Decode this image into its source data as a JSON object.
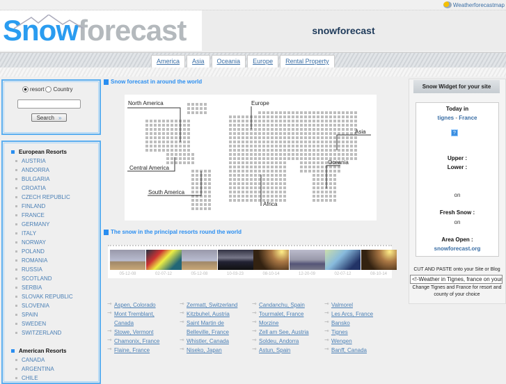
{
  "topbar": {
    "link": "Weatherforecastmap"
  },
  "header": {
    "logo_snow": "Snow",
    "logo_forecast": "forecast",
    "title": "snowforecast"
  },
  "nav": {
    "tabs": [
      "America",
      "Asia",
      "Oceania",
      "Europe",
      "Rental Property"
    ]
  },
  "search": {
    "option_resort": "resort",
    "option_country": "Country",
    "input_value": "",
    "button": "Search",
    "button_icon": "»"
  },
  "sidebar": {
    "european_title": "European Resorts",
    "european": [
      "AUSTRIA",
      "ANDORRA",
      "BULGARIA",
      "CROATIA",
      "CZECH REPUBLIC",
      "FINLAND",
      "FRANCE",
      "GERMANY",
      "ITALY",
      "NORWAY",
      "POLAND",
      "ROMANIA",
      "RUSSIA",
      "SCOTLAND",
      "SERBIA",
      "SLOVAK REPUBLIC",
      "SLOVENIA",
      "SPAIN",
      "SWEDEN",
      "SWITZERLAND"
    ],
    "american_title": "American Resorts",
    "american": [
      "CANADA",
      "ARGENTINA",
      "CHILE"
    ]
  },
  "main": {
    "map_title": "Snow forecast in around the world",
    "map_labels": {
      "north_america": "North America",
      "europe": "Europe",
      "asia": "Asia",
      "central_america": "Central America",
      "oceania": "Oceania",
      "south_america": "South America",
      "africa": "Africa"
    },
    "photos_title": "The snow in the principal resorts round the world",
    "photo_dates": [
      "05-12-08",
      "02-07-12",
      "05-12-08",
      "10-03-23",
      "08-10-14",
      "12-20-09",
      "02-07-12",
      "08-10-14"
    ],
    "resort_columns": [
      [
        "Aspen, Colorado",
        "Mont Tremblant, Canada",
        "Stowe, Vermont",
        "Chamonix, France",
        "Flaine, France"
      ],
      [
        "Zermatt, Switzerland",
        "Kitzbuhel, Austria",
        "Saint Martin de Belleville, France",
        "Whistler, Canada",
        "Niseko, Japan"
      ],
      [
        "Candanchu, Spain",
        "Tourmalet, France",
        "Morzine",
        "Zell am See, Austria",
        "Soldeu, Andorra",
        "Astun, Spain"
      ],
      [
        "Valmorel",
        "Les Arcs, France",
        "Bansko",
        "Tignes",
        "Wengen",
        "Banff, Canada"
      ]
    ]
  },
  "widget": {
    "title": "Snow Widget for your site",
    "today_in": "Today in",
    "resort": "tignes",
    "sep": "-",
    "country": "France",
    "icon": "?",
    "upper": "Upper :",
    "lower": "Lower :",
    "on1": "on",
    "fresh": "Fresh Snow :",
    "on2": "on",
    "area": "Area Open :",
    "site": "snowforecast.org",
    "cut": "CUT AND PASTE onto your Site or Blog",
    "code": "<!-Weather in Tignes, france on your",
    "help": "Change Tignes and France for resort and county of your choice"
  },
  "colors": {
    "accent": "#2a9cf0",
    "link": "#3a6ea5"
  }
}
